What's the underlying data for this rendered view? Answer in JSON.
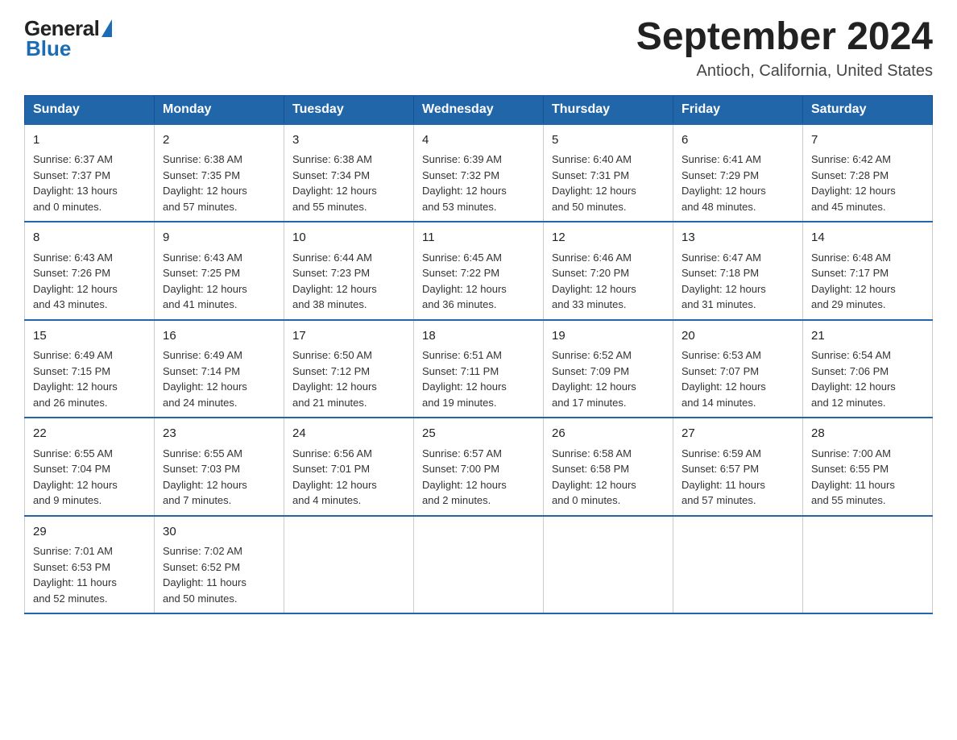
{
  "header": {
    "logo_general": "General",
    "logo_blue": "Blue",
    "month_title": "September 2024",
    "location": "Antioch, California, United States"
  },
  "days_of_week": [
    "Sunday",
    "Monday",
    "Tuesday",
    "Wednesday",
    "Thursday",
    "Friday",
    "Saturday"
  ],
  "weeks": [
    [
      {
        "day": "1",
        "sunrise": "6:37 AM",
        "sunset": "7:37 PM",
        "daylight": "13 hours and 0 minutes."
      },
      {
        "day": "2",
        "sunrise": "6:38 AM",
        "sunset": "7:35 PM",
        "daylight": "12 hours and 57 minutes."
      },
      {
        "day": "3",
        "sunrise": "6:38 AM",
        "sunset": "7:34 PM",
        "daylight": "12 hours and 55 minutes."
      },
      {
        "day": "4",
        "sunrise": "6:39 AM",
        "sunset": "7:32 PM",
        "daylight": "12 hours and 53 minutes."
      },
      {
        "day": "5",
        "sunrise": "6:40 AM",
        "sunset": "7:31 PM",
        "daylight": "12 hours and 50 minutes."
      },
      {
        "day": "6",
        "sunrise": "6:41 AM",
        "sunset": "7:29 PM",
        "daylight": "12 hours and 48 minutes."
      },
      {
        "day": "7",
        "sunrise": "6:42 AM",
        "sunset": "7:28 PM",
        "daylight": "12 hours and 45 minutes."
      }
    ],
    [
      {
        "day": "8",
        "sunrise": "6:43 AM",
        "sunset": "7:26 PM",
        "daylight": "12 hours and 43 minutes."
      },
      {
        "day": "9",
        "sunrise": "6:43 AM",
        "sunset": "7:25 PM",
        "daylight": "12 hours and 41 minutes."
      },
      {
        "day": "10",
        "sunrise": "6:44 AM",
        "sunset": "7:23 PM",
        "daylight": "12 hours and 38 minutes."
      },
      {
        "day": "11",
        "sunrise": "6:45 AM",
        "sunset": "7:22 PM",
        "daylight": "12 hours and 36 minutes."
      },
      {
        "day": "12",
        "sunrise": "6:46 AM",
        "sunset": "7:20 PM",
        "daylight": "12 hours and 33 minutes."
      },
      {
        "day": "13",
        "sunrise": "6:47 AM",
        "sunset": "7:18 PM",
        "daylight": "12 hours and 31 minutes."
      },
      {
        "day": "14",
        "sunrise": "6:48 AM",
        "sunset": "7:17 PM",
        "daylight": "12 hours and 29 minutes."
      }
    ],
    [
      {
        "day": "15",
        "sunrise": "6:49 AM",
        "sunset": "7:15 PM",
        "daylight": "12 hours and 26 minutes."
      },
      {
        "day": "16",
        "sunrise": "6:49 AM",
        "sunset": "7:14 PM",
        "daylight": "12 hours and 24 minutes."
      },
      {
        "day": "17",
        "sunrise": "6:50 AM",
        "sunset": "7:12 PM",
        "daylight": "12 hours and 21 minutes."
      },
      {
        "day": "18",
        "sunrise": "6:51 AM",
        "sunset": "7:11 PM",
        "daylight": "12 hours and 19 minutes."
      },
      {
        "day": "19",
        "sunrise": "6:52 AM",
        "sunset": "7:09 PM",
        "daylight": "12 hours and 17 minutes."
      },
      {
        "day": "20",
        "sunrise": "6:53 AM",
        "sunset": "7:07 PM",
        "daylight": "12 hours and 14 minutes."
      },
      {
        "day": "21",
        "sunrise": "6:54 AM",
        "sunset": "7:06 PM",
        "daylight": "12 hours and 12 minutes."
      }
    ],
    [
      {
        "day": "22",
        "sunrise": "6:55 AM",
        "sunset": "7:04 PM",
        "daylight": "12 hours and 9 minutes."
      },
      {
        "day": "23",
        "sunrise": "6:55 AM",
        "sunset": "7:03 PM",
        "daylight": "12 hours and 7 minutes."
      },
      {
        "day": "24",
        "sunrise": "6:56 AM",
        "sunset": "7:01 PM",
        "daylight": "12 hours and 4 minutes."
      },
      {
        "day": "25",
        "sunrise": "6:57 AM",
        "sunset": "7:00 PM",
        "daylight": "12 hours and 2 minutes."
      },
      {
        "day": "26",
        "sunrise": "6:58 AM",
        "sunset": "6:58 PM",
        "daylight": "12 hours and 0 minutes."
      },
      {
        "day": "27",
        "sunrise": "6:59 AM",
        "sunset": "6:57 PM",
        "daylight": "11 hours and 57 minutes."
      },
      {
        "day": "28",
        "sunrise": "7:00 AM",
        "sunset": "6:55 PM",
        "daylight": "11 hours and 55 minutes."
      }
    ],
    [
      {
        "day": "29",
        "sunrise": "7:01 AM",
        "sunset": "6:53 PM",
        "daylight": "11 hours and 52 minutes."
      },
      {
        "day": "30",
        "sunrise": "7:02 AM",
        "sunset": "6:52 PM",
        "daylight": "11 hours and 50 minutes."
      },
      null,
      null,
      null,
      null,
      null
    ]
  ],
  "labels": {
    "sunrise": "Sunrise:",
    "sunset": "Sunset:",
    "daylight": "Daylight:"
  }
}
